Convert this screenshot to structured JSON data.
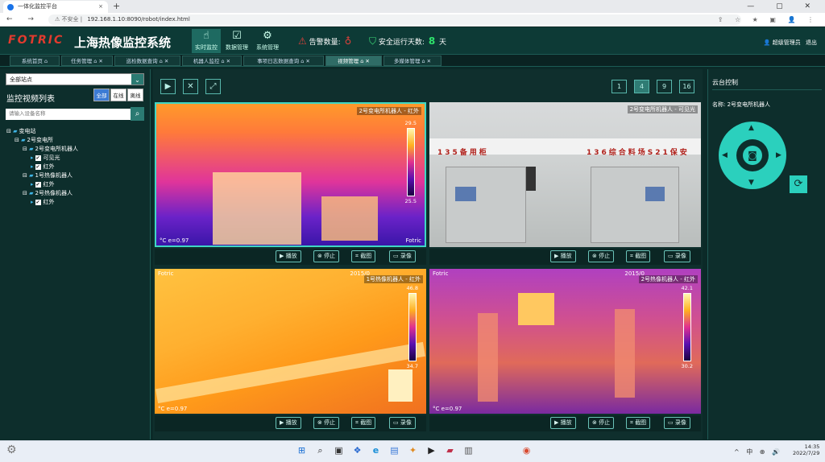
{
  "browser": {
    "tab_title": "一体化监控平台",
    "tab_close": "×",
    "new_tab": "+",
    "window_controls": "— ▢ ✕",
    "nav": "← → ⟳",
    "security_label": "⚠ 不安全 |",
    "url": "192.168.1.10:8090/robot/index.html",
    "icons": "⇪ ☆ ★ ▣ 👤 ⋮"
  },
  "header": {
    "logo": "FOTRIC",
    "title": "上海热像监控系统",
    "nav": [
      {
        "label": "实时监控",
        "icon": "☝",
        "active": true
      },
      {
        "label": "数据管理",
        "icon": "☑",
        "active": false
      },
      {
        "label": "系统管理",
        "icon": "⚙",
        "active": false
      }
    ],
    "alarm_label": "告警数量:",
    "safe_label": "安全运行天数:",
    "safe_days": "8",
    "safe_unit": "天",
    "user": "超级管理员",
    "logout": "退出"
  },
  "subtabs": [
    {
      "label": "系统首页",
      "active": false
    },
    {
      "label": "任务管理",
      "active": false
    },
    {
      "label": "巡检数据查询",
      "active": false
    },
    {
      "label": "机器人监控",
      "active": false
    },
    {
      "label": "事项日志数据查询",
      "active": false
    },
    {
      "label": "视频管理",
      "active": true
    },
    {
      "label": "多媒体管理",
      "active": false
    }
  ],
  "left": {
    "site_select": "全部站点",
    "list_title": "监控视频列表",
    "filters": [
      "全部",
      "在线",
      "离线"
    ],
    "search_placeholder": "请输入设备名称",
    "tree": [
      {
        "level": 0,
        "type": "folder",
        "label": "变电站"
      },
      {
        "level": 1,
        "type": "folder",
        "label": "2号变电所"
      },
      {
        "level": 2,
        "type": "folder",
        "label": "2号变电所机器人"
      },
      {
        "level": 3,
        "type": "item",
        "label": "可见光"
      },
      {
        "level": 3,
        "type": "item",
        "label": "红外"
      },
      {
        "level": 2,
        "type": "folder",
        "label": "1号热像机器人"
      },
      {
        "level": 3,
        "type": "item",
        "label": "红外"
      },
      {
        "level": 2,
        "type": "folder",
        "label": "2号热像机器人"
      },
      {
        "level": 3,
        "type": "item",
        "label": "红外"
      }
    ]
  },
  "toolbar": {
    "play_icon": "▶",
    "stop_icon": "✕",
    "fullscreen_icon": "⤢",
    "layouts": [
      "1",
      "4",
      "9",
      "16"
    ],
    "active_layout": "4"
  },
  "videos": [
    {
      "caption": "2号变电所机器人 - 红外",
      "top_left": "",
      "date": "",
      "bottom_left": "°C  e=0.97",
      "bottom_right": "Fotric",
      "scale_max": "29.5",
      "scale_min": "25.5"
    },
    {
      "caption": "2号变电所机器人 - 可见光",
      "top_left": "",
      "date": "",
      "bottom_left": "",
      "bottom_right": "",
      "scale_max": "",
      "scale_min": "",
      "sign1": "135备用柜",
      "sign2": "136综合料场S21保安"
    },
    {
      "caption": "1号热像机器人 - 红外",
      "top_left": "Fotric",
      "date": "2015/0",
      "bottom_left": "°C  e=0.97",
      "bottom_right": "",
      "scale_max": "46.8",
      "scale_min": "34.7"
    },
    {
      "caption": "2号热像机器人 - 红外",
      "top_left": "Fotric",
      "date": "2015/0",
      "bottom_left": "°C  e=0.97",
      "bottom_right": "",
      "scale_max": "42.1",
      "scale_min": "30.2"
    }
  ],
  "video_controls": [
    {
      "icon": "▶",
      "label": "播放"
    },
    {
      "icon": "⊗",
      "label": "停止"
    },
    {
      "icon": "⌗",
      "label": "截图"
    },
    {
      "icon": "▭",
      "label": "录像"
    }
  ],
  "right": {
    "title": "云台控制",
    "name_label": "名称:",
    "name_value": "2号变电所机器人",
    "up": "▲",
    "down": "▼",
    "left": "◀",
    "right": "▶",
    "center": "◙",
    "refresh": "⟳"
  },
  "taskbar": {
    "tray": "^ 中 ⊕ 🔊",
    "time": "14:35",
    "date": "2022/7/29",
    "apps": [
      "⊞",
      "⌕",
      "▣",
      "❖",
      "e",
      "▤",
      "✦",
      "▶",
      "▰",
      "▥",
      "◉"
    ]
  },
  "colors": {
    "accent": "#2bd0bd",
    "header_bg": "#0d3a36",
    "alarm": "#e0403a",
    "safe": "#2ee36c",
    "selected_frame": "#3fd6c4"
  }
}
